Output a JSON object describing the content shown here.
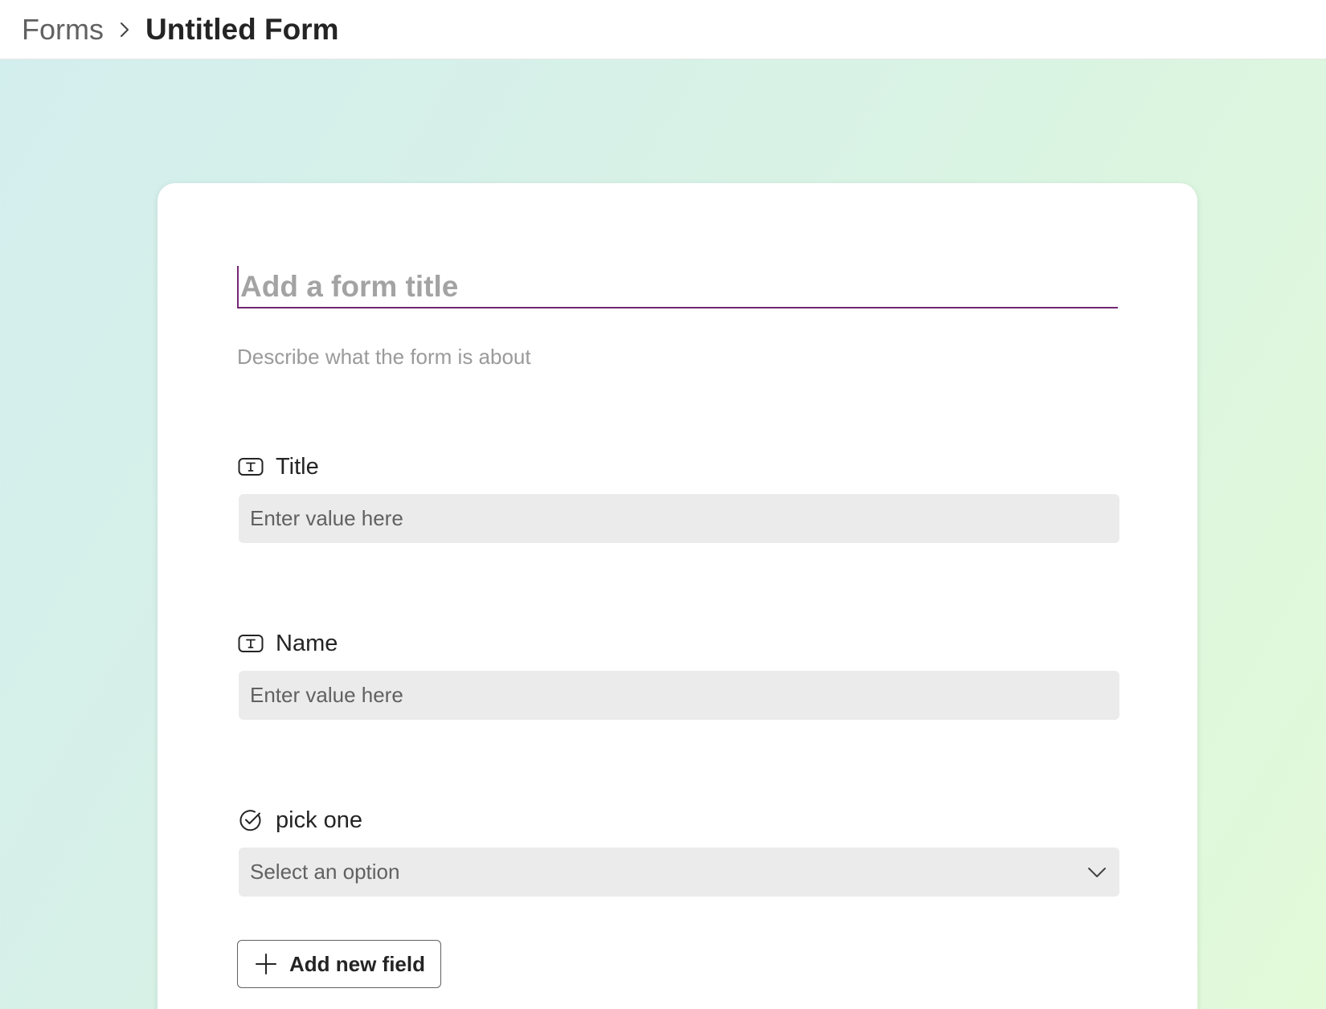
{
  "breadcrumb": {
    "root": "Forms",
    "current": "Untitled Form"
  },
  "form": {
    "title_placeholder": "Add a form title",
    "description_placeholder": "Describe what the form is about",
    "fields": [
      {
        "label": "Title",
        "icon": "text-field-icon",
        "placeholder": "Enter value here"
      },
      {
        "label": "Name",
        "icon": "text-field-icon",
        "placeholder": "Enter value here"
      },
      {
        "label": "pick one",
        "icon": "choice-check-icon",
        "selected": "Select an option"
      }
    ],
    "add_field_label": "Add new field"
  },
  "colors": {
    "accent": "#742774",
    "input_bg": "#ebebeb"
  }
}
